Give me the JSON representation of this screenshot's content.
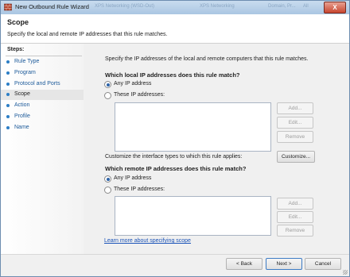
{
  "window": {
    "title": "New Outbound Rule Wizard",
    "background_tabs": [
      "XPS Networking (WSD-Out)",
      "XPS Networking",
      "Domain, Pr...",
      "All"
    ],
    "close_label": "X"
  },
  "header": {
    "title": "Scope",
    "description": "Specify the local and remote IP addresses that this rule matches."
  },
  "steps": {
    "title": "Steps:",
    "items": [
      {
        "label": "Rule Type",
        "current": false
      },
      {
        "label": "Program",
        "current": false
      },
      {
        "label": "Protocol and Ports",
        "current": false
      },
      {
        "label": "Scope",
        "current": true
      },
      {
        "label": "Action",
        "current": false
      },
      {
        "label": "Profile",
        "current": false
      },
      {
        "label": "Name",
        "current": false
      }
    ]
  },
  "main": {
    "intro": "Specify the IP addresses of the local and remote computers that this rule matches.",
    "local": {
      "question": "Which local IP addresses does this rule match?",
      "option_any": "Any IP address",
      "option_these": "These IP addresses:",
      "selected": "any",
      "buttons": {
        "add": "Add...",
        "edit": "Edit...",
        "remove": "Remove"
      }
    },
    "interface": {
      "text": "Customize the interface types to which this rule applies:",
      "button": "Customize..."
    },
    "remote": {
      "question": "Which remote IP addresses does this rule match?",
      "option_any": "Any IP address",
      "option_these": "These IP addresses:",
      "selected": "any",
      "buttons": {
        "add": "Add...",
        "edit": "Edit...",
        "remove": "Remove"
      }
    },
    "learn_link": "Learn more about specifying scope"
  },
  "footer": {
    "back": "< Back",
    "next": "Next >",
    "cancel": "Cancel"
  }
}
